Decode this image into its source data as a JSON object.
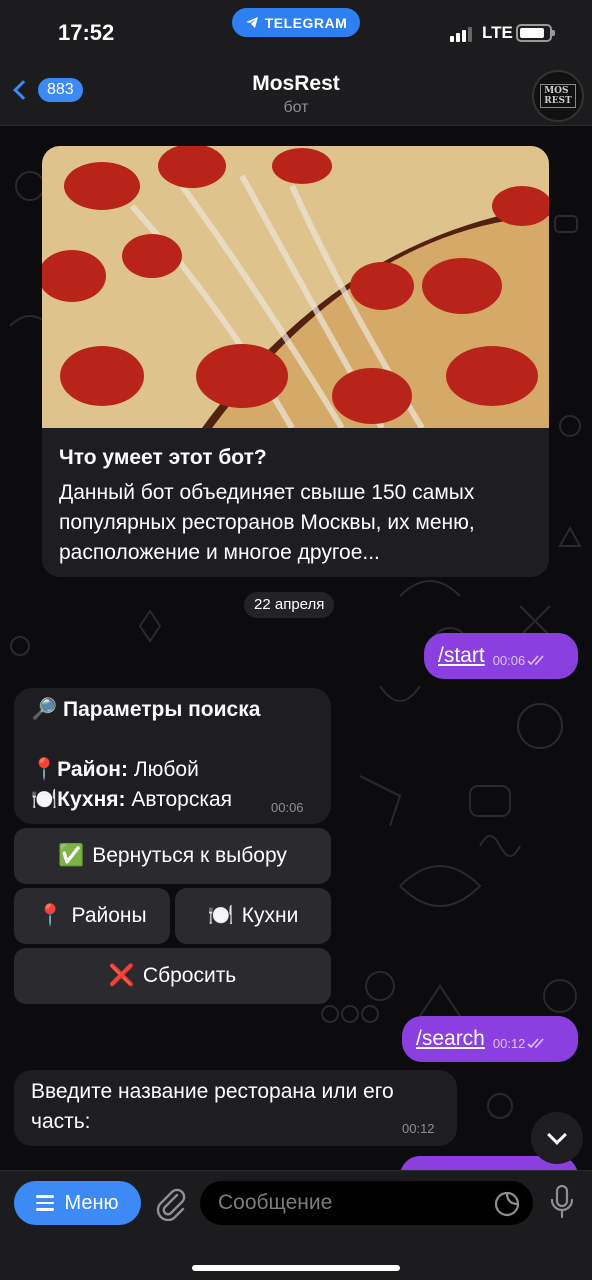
{
  "status_bar": {
    "time": "17:52",
    "app_pill": "TELEGRAM",
    "network": "LTE"
  },
  "header": {
    "back_count": "883",
    "title": "MosRest",
    "subtitle": "бот",
    "avatar_text_1": "MOS",
    "avatar_text_2": "REST"
  },
  "intro_card": {
    "title": "Что умеет этот бот?",
    "text": "Данный бот объединяет свыше 150 самых популярных ресторанов Москвы, их меню, расположение и многое другое..."
  },
  "date_divider": "22 апреля",
  "messages": {
    "out_start": {
      "text": "/start",
      "time": "00:06"
    },
    "search_params": {
      "icon_title": "🔎",
      "title": "Параметры поиска",
      "district_icon": "📍",
      "district_label": "Район:",
      "district_value": "Любой",
      "cuisine_icon": "🍽️",
      "cuisine_label": "Кухня:",
      "cuisine_value": "Авторская",
      "time": "00:06"
    },
    "out_search": {
      "text": "/search",
      "time": "00:12"
    },
    "prompt": {
      "line1": "Введите название ресторана или его",
      "line2": "часть:",
      "time": "00:12"
    }
  },
  "inline_keyboard": {
    "back_to_choice": {
      "icon": "✅",
      "label": "Вернуться к выбору"
    },
    "districts": {
      "icon": "📍",
      "label": "Районы"
    },
    "cuisines": {
      "icon": "🍽️",
      "label": "Кухни"
    },
    "reset": {
      "icon": "❌",
      "label": "Сбросить"
    }
  },
  "composer": {
    "menu_label": "Меню",
    "placeholder": "Сообщение"
  },
  "colors": {
    "accent": "#3d8af7",
    "outgoing_bubble": "#8b3fe0",
    "incoming_bubble": "#1e1e22"
  },
  "icons": [
    "telegram-icon",
    "back-chevron-icon",
    "hamburger-icon",
    "paperclip-icon",
    "sticker-icon",
    "microphone-icon",
    "chevron-down-icon",
    "double-check-icon"
  ]
}
